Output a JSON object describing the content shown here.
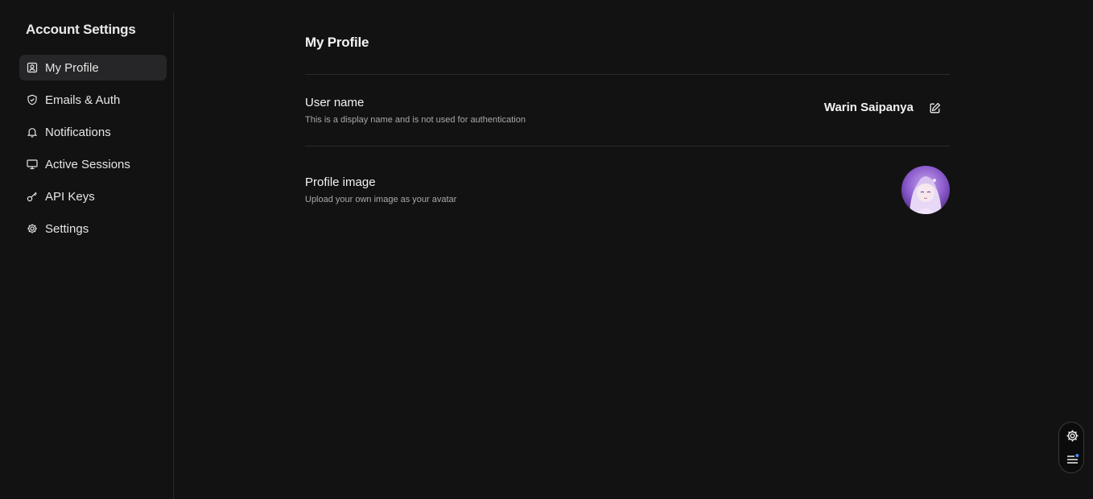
{
  "sidebar": {
    "title": "Account Settings",
    "items": [
      {
        "label": "My Profile",
        "icon": "profile-icon",
        "active": true
      },
      {
        "label": "Emails & Auth",
        "icon": "shield-icon",
        "active": false
      },
      {
        "label": "Notifications",
        "icon": "bell-icon",
        "active": false
      },
      {
        "label": "Active Sessions",
        "icon": "monitor-icon",
        "active": false
      },
      {
        "label": "API Keys",
        "icon": "key-icon",
        "active": false
      },
      {
        "label": "Settings",
        "icon": "gear-icon",
        "active": false
      }
    ]
  },
  "main": {
    "title": "My Profile",
    "username": {
      "label": "User name",
      "description": "This is a display name and is not used for authentication",
      "value": "Warin Saipanya"
    },
    "profile_image": {
      "label": "Profile image",
      "description": "Upload your own image as your avatar"
    }
  },
  "colors": {
    "background": "#131213",
    "active_nav": "#262527",
    "divider": "#2b2a2b",
    "muted_text": "#a9a8a9",
    "avatar_accent": "#9b6fd6",
    "notification_dot": "#4a8cff"
  }
}
